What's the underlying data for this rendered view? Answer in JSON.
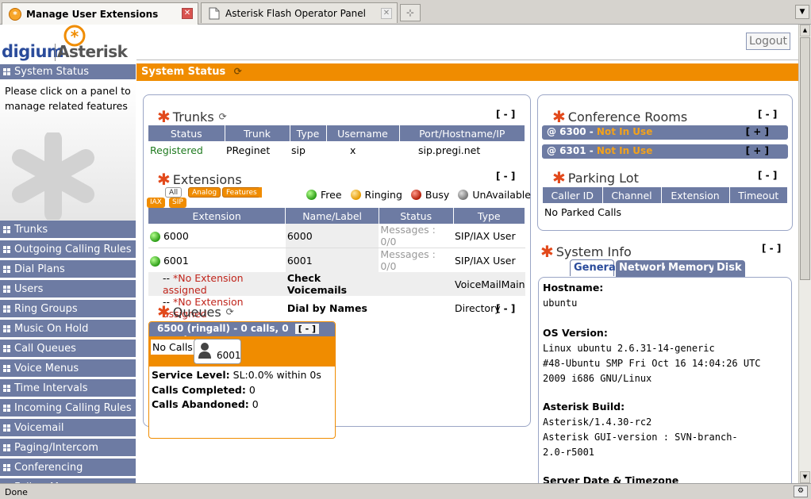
{
  "browser": {
    "tabs": [
      {
        "title": "Manage User Extensions"
      },
      {
        "title": "Asterisk Flash Operator Panel"
      }
    ],
    "status_text": "Done"
  },
  "header": {
    "logo_digium": "digium",
    "logo_asterisk": "Asterisk",
    "logout_label": "Logout"
  },
  "sidebar": {
    "active_label": "System Status",
    "description": "Please click on a panel to manage related features",
    "items": [
      "Trunks",
      "Outgoing Calling Rules",
      "Dial Plans",
      "Users",
      "Ring Groups",
      "Music On Hold",
      "Call Queues",
      "Voice Menus",
      "Time Intervals",
      "Incoming Calling Rules",
      "Voicemail",
      "Paging/Intercom",
      "Conferencing",
      "Follow Me"
    ]
  },
  "main": {
    "title": "System Status",
    "collapse": "[ - ]",
    "expand": "[ + ]",
    "trunks": {
      "title": "Trunks",
      "headers": [
        "Status",
        "Trunk",
        "Type",
        "Username",
        "Port/Hostname/IP"
      ],
      "rows": [
        {
          "status": "Registered",
          "trunk": "PReginet",
          "type": "sip",
          "username": "x",
          "host": "sip.pregi.net"
        }
      ]
    },
    "extensions": {
      "title": "Extensions",
      "filters": [
        "All",
        "Analog",
        "Features",
        "IAX",
        "SIP"
      ],
      "legend": [
        "Free",
        "Ringing",
        "Busy",
        "UnAvailable"
      ],
      "headers": [
        "Extension",
        "Name/Label",
        "Status",
        "Type"
      ],
      "rows": [
        {
          "ext": "6000",
          "name": "6000",
          "status": "Messages : 0/0",
          "type": "SIP/IAX User"
        },
        {
          "ext": "6001",
          "name": "6001",
          "status": "Messages : 0/0",
          "type": "SIP/IAX User"
        },
        {
          "ext": "-- ",
          "ext_note": "*No Extension assigned",
          "name": "Check Voicemails",
          "status": "",
          "type": "VoiceMailMain"
        },
        {
          "ext": "-- ",
          "ext_note": "*No Extension assigned",
          "name": "Dial by Names",
          "status": "",
          "type": "Directory"
        }
      ]
    },
    "queues": {
      "title": "Queues",
      "queue_header": "6500 (ringall) - 0 calls, 0 agents",
      "no_calls": "No Calls",
      "agent": "6001",
      "service_level_label": "Service Level:",
      "service_level_value": "SL:0.0% within 0s",
      "completed_label": "Calls Completed:",
      "completed_value": "0",
      "abandoned_label": "Calls Abandoned:",
      "abandoned_value": "0"
    },
    "conference": {
      "title": "Conference Rooms",
      "rooms": [
        {
          "room": "@ 6300 - ",
          "status": "Not In Use"
        },
        {
          "room": "@ 6301 - ",
          "status": "Not In Use"
        }
      ]
    },
    "parking": {
      "title": "Parking Lot",
      "headers": [
        "Caller ID",
        "Channel",
        "Extension",
        "Timeout"
      ],
      "empty": "No Parked Calls"
    },
    "sysinfo": {
      "title": "System Info",
      "tabs": [
        "General",
        "Network",
        "Memory",
        "Disk"
      ],
      "hostname_label": "Hostname:",
      "hostname": "ubuntu",
      "os_label": "OS Version:",
      "os_line1": "Linux ubuntu 2.6.31-14-generic",
      "os_line2": "#48-Ubuntu SMP Fri Oct 16 14:04:26 UTC",
      "os_line3": "2009 i686 GNU/Linux",
      "build_label": "Asterisk Build:",
      "build_line1": "Asterisk/1.4.30-rc2",
      "build_line2": "Asterisk GUI-version : SVN-branch-",
      "build_line3": "2.0-r5001",
      "date_label": "Server Date & Timezone"
    }
  },
  "colors": {
    "accent": "#f08c00",
    "sidebar": "#6d7ba3",
    "asterisk_star": "#e2491b"
  }
}
